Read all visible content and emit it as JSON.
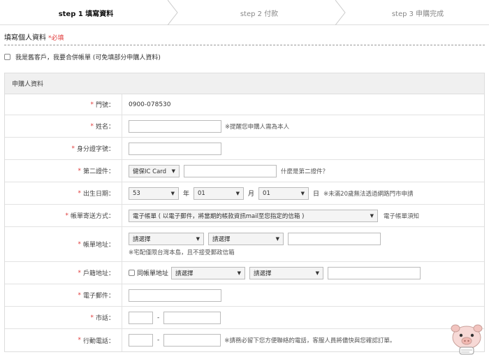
{
  "steps": [
    {
      "label": "step 1 填寫資料",
      "active": true
    },
    {
      "label": "step 2 付款",
      "active": false
    },
    {
      "label": "step 3 申購完成",
      "active": false
    }
  ],
  "section": {
    "title": "填寫個人資料",
    "required_mark": "*必填"
  },
  "existing_customer": {
    "label": "我是舊客戶，我要合併帳單 (可免填部分申購人資料)"
  },
  "table_header": "申購人資料",
  "rows": {
    "door": {
      "label": "門號：",
      "value": "0900-078530"
    },
    "name": {
      "label": "姓名：",
      "note": "※提醒您申購人需為本人"
    },
    "id": {
      "label": "身分證字號："
    },
    "second_id": {
      "label": "第二證件：",
      "select": "健保IC Card",
      "note": "什麼是第二證件？"
    },
    "birth": {
      "label": "出生日期：",
      "year": "53",
      "year_unit": "年",
      "month": "01",
      "month_unit": "月",
      "day": "01",
      "day_unit": "日",
      "note": "※未滿20歲無法透過網路門市申請"
    },
    "bill_method": {
      "label": "帳單寄送方式：",
      "select": "電子帳單 ( 以電子郵件，將當期的帳款資訊mail至您指定的信箱 )",
      "note": "電子帳單須知"
    },
    "bill_addr": {
      "label": "帳單地址：",
      "city": "請選擇",
      "district": "請選擇",
      "note": "※宅配僅限台灣本島，且不接受郵政信箱"
    },
    "home_addr": {
      "label": "戶籍地址：",
      "same_label": "同帳單地址",
      "city": "請選擇",
      "district": "請選擇"
    },
    "email": {
      "label": "電子郵件："
    },
    "phone": {
      "label": "市話：",
      "dash": "-"
    },
    "mobile": {
      "label": "行動電話：",
      "dash": "-",
      "note": "※請務必留下您方便聯絡的電話，客服人員將儘快與您確認訂單。"
    }
  },
  "required_star": "*",
  "icons": {
    "caret": "caret-down-icon",
    "mascot": "pig-mascot-icon"
  },
  "colors": {
    "required": "#e03a3a",
    "header_bg": "#f0f0f0"
  }
}
